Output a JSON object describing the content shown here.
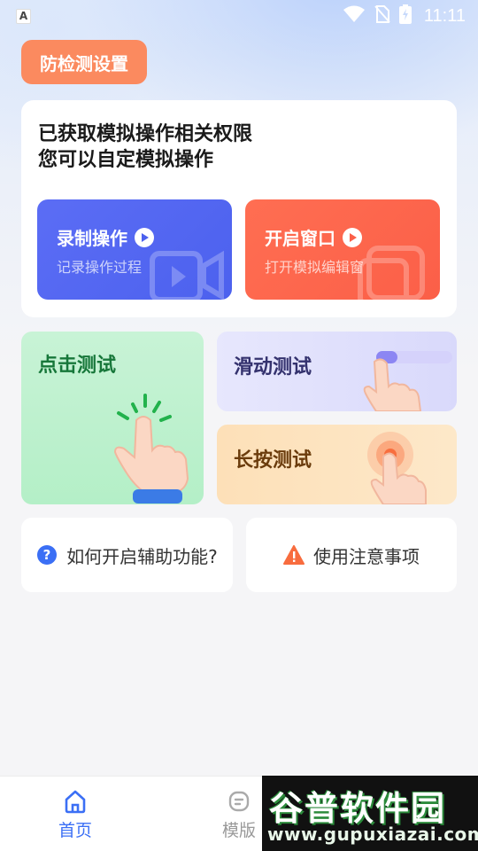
{
  "status_bar": {
    "time": "11:11"
  },
  "header": {
    "anti_detect_label": "防检测设置"
  },
  "permission_card": {
    "title_line1": "已获取模拟操作相关权限",
    "title_line2": "您可以自定模拟操作",
    "record": {
      "title": "录制操作",
      "subtitle": "记录操作过程"
    },
    "window": {
      "title": "开启窗口",
      "subtitle": "打开模拟编辑窗"
    }
  },
  "tests": {
    "click": "点击测试",
    "swipe": "滑动测试",
    "long_press": "长按测试"
  },
  "help": {
    "howto": "如何开启辅助功能?",
    "notes": "使用注意事项"
  },
  "bottom_nav": {
    "items": [
      {
        "label": "首页",
        "icon": "home-icon",
        "active": true
      },
      {
        "label": "模版",
        "icon": "template-icon",
        "active": false
      }
    ]
  },
  "watermark": {
    "title": "谷普软件园",
    "url": "www.gupuxiazai.com"
  },
  "colors": {
    "accent": "#3b6ff5",
    "anti_button": "#fb8a5f",
    "record_card": "#5265f1",
    "window_card": "#fd6650",
    "click_card": "#bff1cf",
    "swipe_card": "#e0e0fc",
    "press_card": "#fde4c0"
  }
}
